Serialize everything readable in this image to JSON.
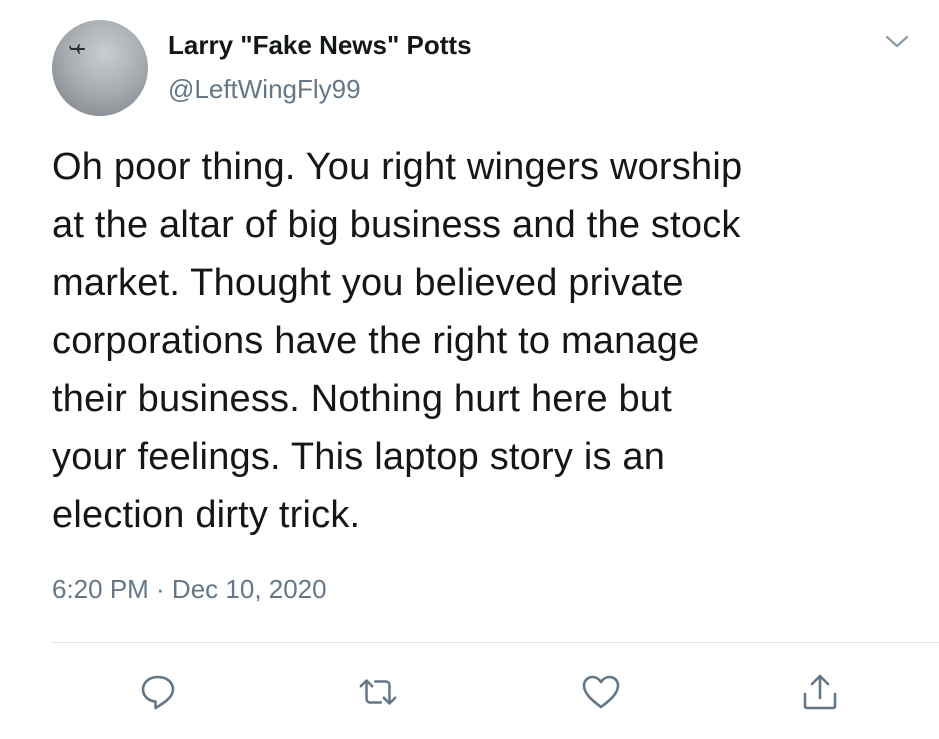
{
  "tweet": {
    "author": {
      "display_name": "Larry \"Fake News\" Potts",
      "handle": "@LeftWingFly99",
      "avatar_icon": "airplane-sky-avatar"
    },
    "text": "Oh poor thing.  You right wingers worship\nat the altar of big business and the stock\nmarket.  Thought you believed private\ncorporations have the right to manage\ntheir business.  Nothing hurt here but\nyour feelings.  This laptop story is an\nelection dirty trick.",
    "timestamp": "6:20 PM · Dec 10, 2020"
  },
  "actions": {
    "reply_icon": "reply-icon",
    "retweet_icon": "retweet-icon",
    "like_icon": "heart-icon",
    "share_icon": "share-icon",
    "menu_icon": "chevron-down-icon"
  },
  "colors": {
    "text_primary": "#14171a",
    "text_secondary": "#657786",
    "icon": "#657786",
    "divider": "#e1e8ed"
  }
}
